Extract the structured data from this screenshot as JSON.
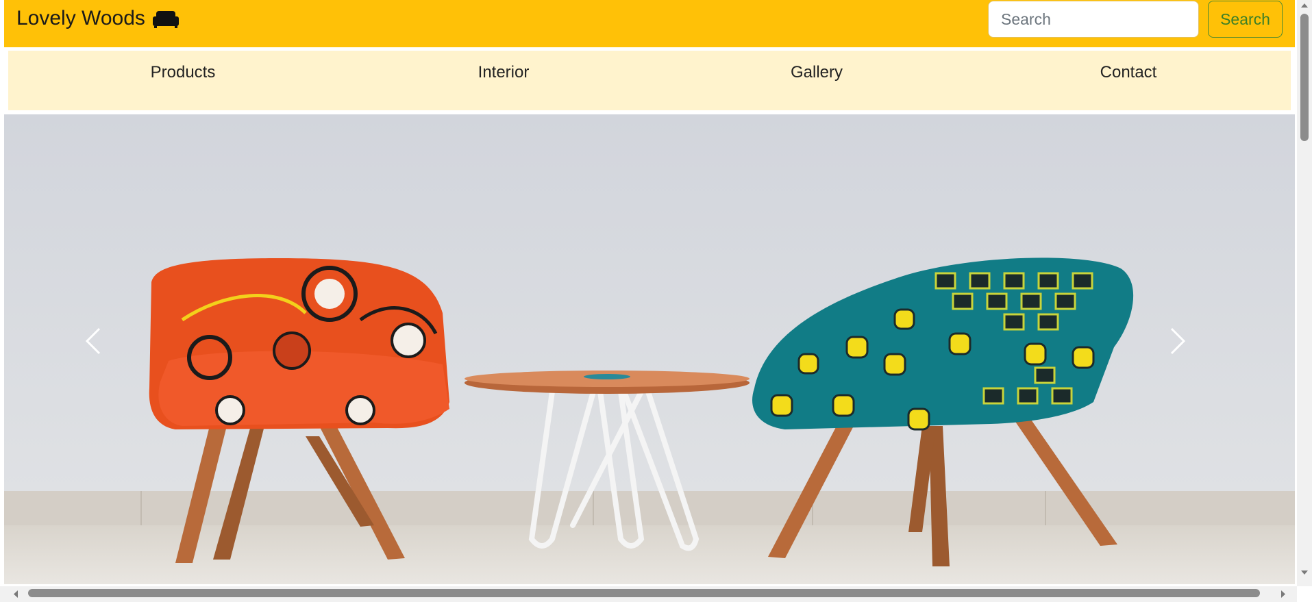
{
  "header": {
    "brand": "Lovely Woods",
    "brand_icon": "sofa-icon",
    "search_placeholder": "Search",
    "search_button_label": "Search"
  },
  "nav": {
    "items": [
      {
        "label": "Products"
      },
      {
        "label": "Interior"
      },
      {
        "label": "Gallery"
      },
      {
        "label": "Contact"
      }
    ]
  },
  "carousel": {
    "prev_icon": "chevron-left-icon",
    "next_icon": "chevron-right-icon"
  },
  "colors": {
    "header_bg": "#ffc107",
    "nav_bg": "#fff3cd",
    "search_button": "#3b7f27"
  }
}
